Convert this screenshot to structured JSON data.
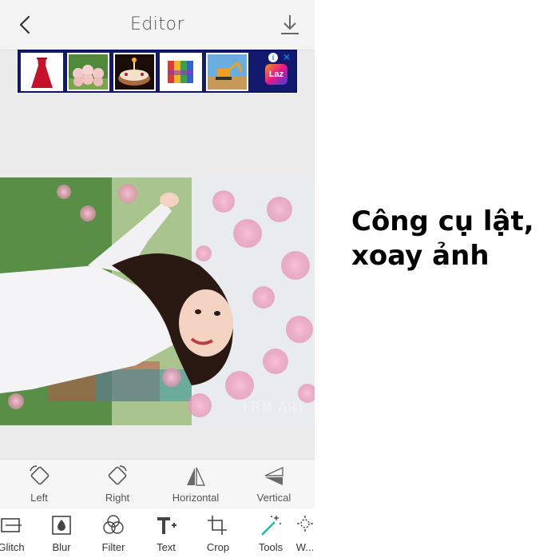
{
  "header": {
    "title": "Editor",
    "back_icon": "chevron-left-icon",
    "download_icon": "download-icon"
  },
  "ad": {
    "brand": "Laz",
    "info_glyph": "i",
    "close_glyph": "×",
    "products": [
      "red-dress",
      "teddy-bears",
      "birthday-cake",
      "magnetic-balls",
      "excavator-toy"
    ]
  },
  "photo": {
    "watermark": "FRM ART"
  },
  "rotate_tools": [
    {
      "label": "Left",
      "icon": "rotate-left-icon"
    },
    {
      "label": "Right",
      "icon": "rotate-right-icon"
    },
    {
      "label": "Horizontal",
      "icon": "flip-horizontal-icon"
    },
    {
      "label": "Vertical",
      "icon": "flip-vertical-icon"
    }
  ],
  "tools": [
    {
      "label": "Glitch",
      "icon": "glitch-icon"
    },
    {
      "label": "Blur",
      "icon": "blur-icon"
    },
    {
      "label": "Filter",
      "icon": "filter-icon"
    },
    {
      "label": "Text",
      "icon": "text-icon"
    },
    {
      "label": "Crop",
      "icon": "crop-icon"
    },
    {
      "label": "Tools",
      "icon": "magic-wand-icon"
    },
    {
      "label": "W...",
      "icon": "sparkle-icon"
    }
  ],
  "caption": {
    "line1": "Công cụ lật,",
    "line2": "xoay ảnh"
  },
  "colors": {
    "ad_background": "#121a6e",
    "toolbar_background": "#f6f6f6",
    "canvas_background": "#ebebeb"
  }
}
